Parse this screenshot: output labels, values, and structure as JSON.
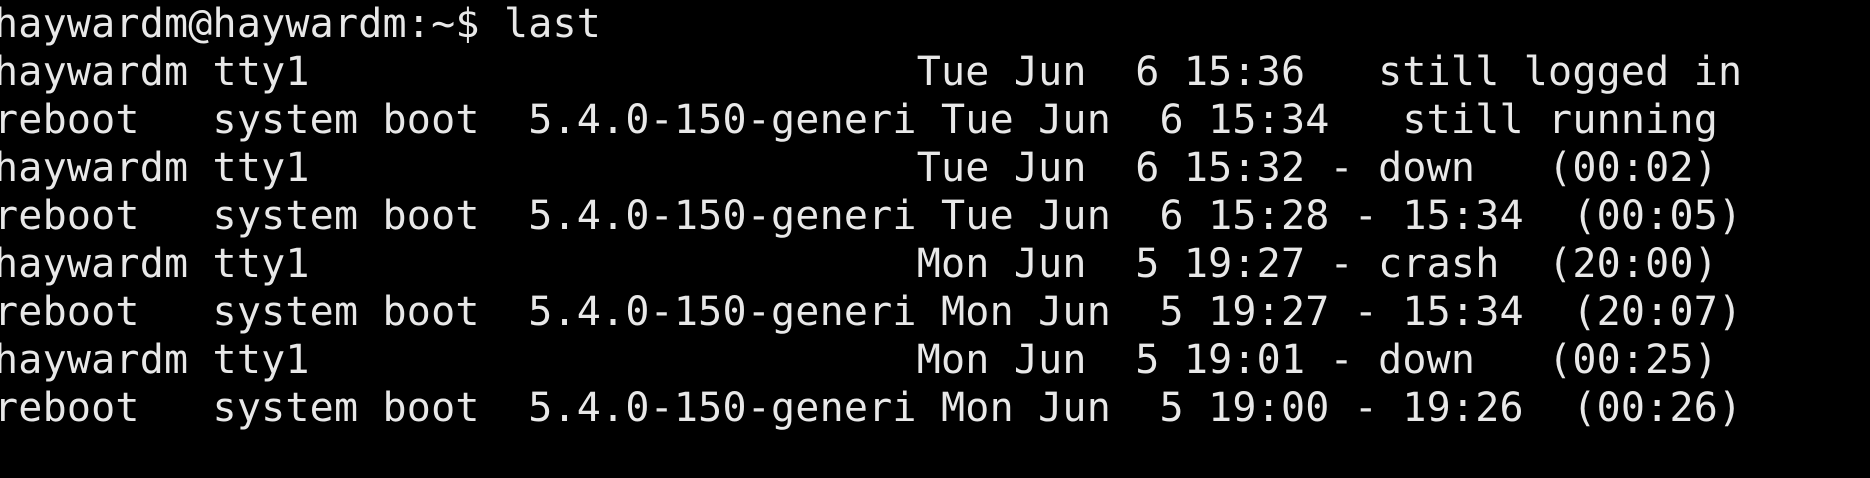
{
  "terminal": {
    "prompt": "haywardm@haywardm:~$ ",
    "command": "last",
    "lines": [
      "haywardm tty1                         Tue Jun  6 15:36   still logged in",
      "reboot   system boot  5.4.0-150-generi Tue Jun  6 15:34   still running",
      "haywardm tty1                         Tue Jun  6 15:32 - down   (00:02)",
      "reboot   system boot  5.4.0-150-generi Tue Jun  6 15:28 - 15:34  (00:05)",
      "haywardm tty1                         Mon Jun  5 19:27 - crash  (20:00)",
      "reboot   system boot  5.4.0-150-generi Mon Jun  5 19:27 - 15:34  (20:07)",
      "haywardm tty1                         Mon Jun  5 19:01 - down   (00:25)",
      "reboot   system boot  5.4.0-150-generi Mon Jun  5 19:00 - 19:26  (00:26)"
    ]
  },
  "colors": {
    "background": "#000000",
    "foreground": "#e8e8e8"
  }
}
